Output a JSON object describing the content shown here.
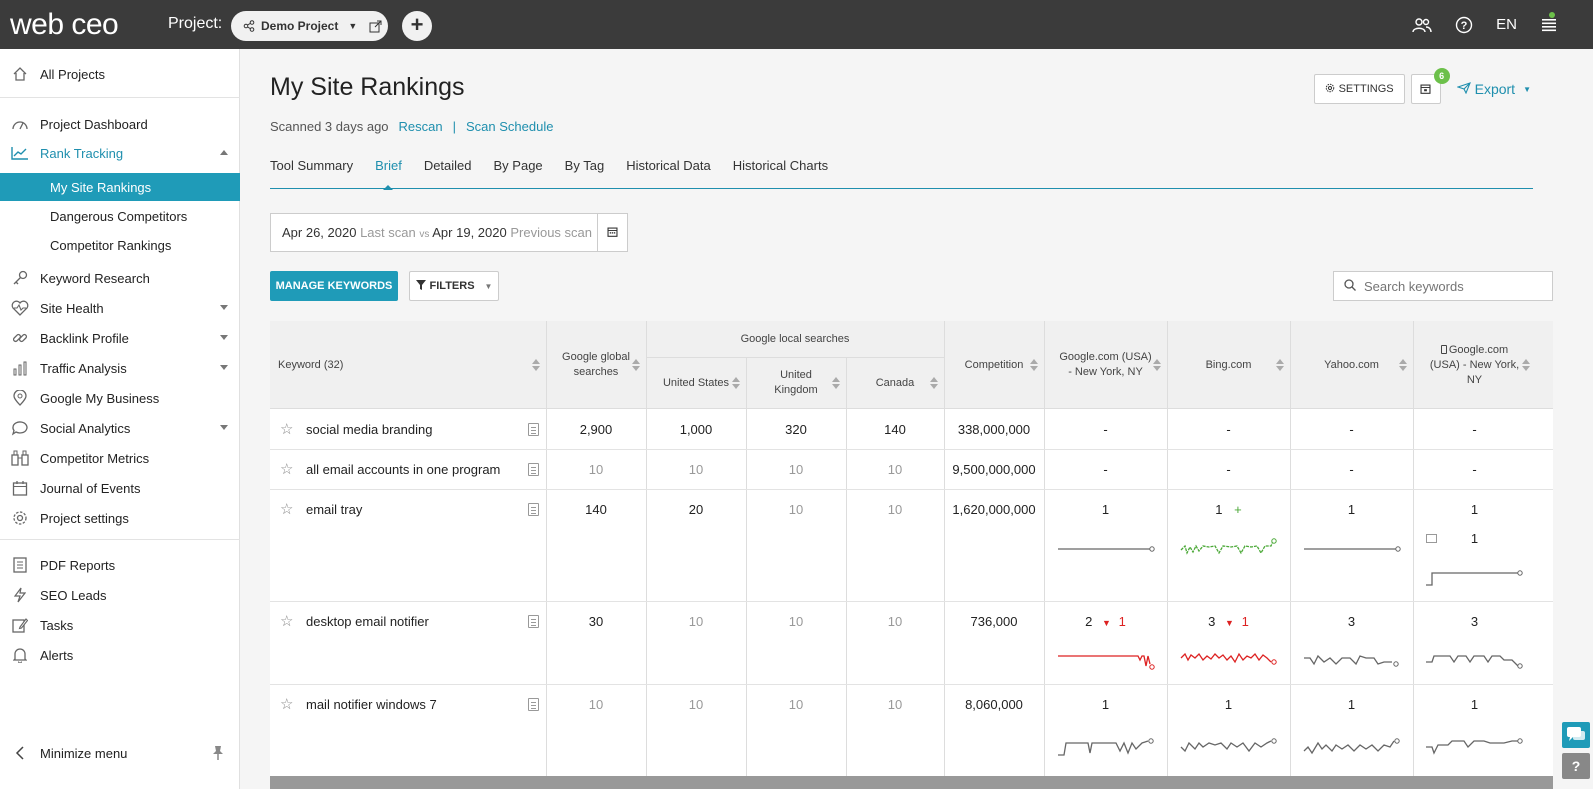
{
  "topbar": {
    "logo": "web ceo",
    "project_label": "Project:",
    "project_name": "Demo Project",
    "add_label": "+",
    "lang": "EN"
  },
  "sidebar": {
    "all_projects": "All Projects",
    "project_dashboard": "Project Dashboard",
    "rank_tracking": "Rank Tracking",
    "sub_items": [
      "My Site Rankings",
      "Dangerous Competitors",
      "Competitor Rankings"
    ],
    "keyword_research": "Keyword Research",
    "site_health": "Site Health",
    "backlink_profile": "Backlink Profile",
    "traffic_analysis": "Traffic Analysis",
    "google_my_business": "Google My Business",
    "social_analytics": "Social Analytics",
    "competitor_metrics": "Competitor Metrics",
    "journal_of_events": "Journal of Events",
    "project_settings": "Project settings",
    "pdf_reports": "PDF Reports",
    "seo_leads": "SEO Leads",
    "tasks": "Tasks",
    "alerts": "Alerts",
    "minimize_menu": "Minimize menu"
  },
  "page": {
    "title": "My Site Rankings",
    "scanned": "Scanned 3 days ago",
    "rescan": "Rescan",
    "separator": "|",
    "scan_schedule": "Scan Schedule",
    "settings_label": "SETTINGS",
    "badge_count": "6",
    "export_label": "Export"
  },
  "tabs": [
    "Tool Summary",
    "Brief",
    "Detailed",
    "By Page",
    "By Tag",
    "Historical Data",
    "Historical Charts"
  ],
  "dates": {
    "last_date": "Apr 26, 2020",
    "last_label": "Last scan",
    "vs": "vs",
    "prev_date": "Apr 19, 2020",
    "prev_label": "Previous scan"
  },
  "toolbar": {
    "manage_keywords": "MANAGE KEYWORDS",
    "filters": "FILTERS",
    "search_placeholder": "Search keywords"
  },
  "table": {
    "headers": {
      "keyword": "Keyword (32)",
      "google_global": "Google global searches",
      "local_group": "Google local searches",
      "us": "United States",
      "uk": "United Kingdom",
      "canada": "Canada",
      "competition": "Competition",
      "google_ny": "Google.com (USA) - New York, NY",
      "bing": "Bing.com",
      "yahoo": "Yahoo.com",
      "google_mobile": "Google.com (USA) - New York, NY"
    },
    "rows": [
      {
        "keyword": "social media branding",
        "global": "2,900",
        "us": "1,000",
        "uk": "320",
        "ca": "140",
        "competition": "338,000,000",
        "google": "-",
        "bing": "-",
        "yahoo": "-",
        "mobile": "-"
      },
      {
        "keyword": "all email accounts in one program",
        "global": "10",
        "us": "10",
        "uk": "10",
        "ca": "10",
        "competition": "9,500,000,000",
        "google": "-",
        "bing": "-",
        "yahoo": "-",
        "mobile": "-"
      },
      {
        "keyword": "email tray",
        "global": "140",
        "us": "20",
        "uk": "10",
        "ca": "10",
        "competition": "1,620,000,000",
        "google": "1",
        "bing": "1",
        "bing_change": "+",
        "yahoo": "1",
        "mobile": "1",
        "mobile_sub": "1"
      },
      {
        "keyword": "desktop email notifier",
        "global": "30",
        "us": "10",
        "uk": "10",
        "ca": "10",
        "competition": "736,000",
        "google": "2",
        "google_change": "1",
        "bing": "3",
        "bing_change": "1",
        "yahoo": "3",
        "mobile": "3"
      },
      {
        "keyword": "mail notifier windows 7",
        "global": "10",
        "us": "10",
        "uk": "10",
        "ca": "10",
        "competition": "8,060,000",
        "google": "1",
        "bing": "1",
        "yahoo": "1",
        "mobile": "1"
      }
    ]
  },
  "colors": {
    "accent": "#1f9bb8",
    "topbar": "#3b3b3b",
    "up": "#4aa836",
    "down": "#dd2222"
  }
}
